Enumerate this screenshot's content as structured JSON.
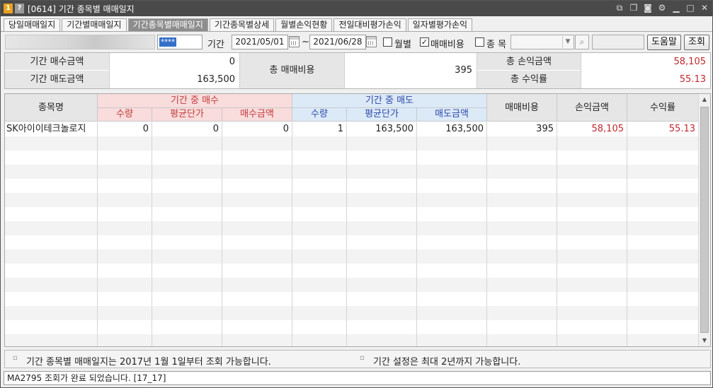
{
  "title": {
    "badge_num": "1",
    "badge_help": "?",
    "text": "[0614] 기간 종목별 매매일지"
  },
  "window_icons": [
    "link-icon",
    "copy-icon",
    "camera-icon",
    "gear-icon",
    "minimize-icon",
    "maximize-icon",
    "close-icon"
  ],
  "tabs": [
    {
      "label": "당일매매일지",
      "active": false
    },
    {
      "label": "기간별매매일지",
      "active": false
    },
    {
      "label": "기간종목별매매일지",
      "active": true
    },
    {
      "label": "기간종목별상세",
      "active": false
    },
    {
      "label": "월별손익현황",
      "active": false
    },
    {
      "label": "전일대비평가손익",
      "active": false
    },
    {
      "label": "일자별평가손익",
      "active": false
    }
  ],
  "toolbar": {
    "password_mask": "****",
    "period_label": "기간",
    "date_from": "2021/05/01",
    "tilde": "~",
    "date_to": "2021/06/28",
    "monthly_label": "월별",
    "monthly_checked": false,
    "fee_label": "매매비용",
    "fee_checked": true,
    "stock_label": "종 목",
    "stock_checked": false,
    "help_button": "도움말",
    "query_button": "조회"
  },
  "summary": {
    "buy_amount_label": "기간 매수금액",
    "buy_amount_value": "0",
    "sell_amount_label": "기간 매도금액",
    "sell_amount_value": "163,500",
    "total_fee_label": "총 매매비용",
    "total_fee_value": "395",
    "total_pnl_label": "총 손익금액",
    "total_pnl_value": "58,105",
    "total_return_label": "총 수익률",
    "total_return_value": "55.13"
  },
  "grid": {
    "col_name": "종목명",
    "buy_group": "기간 중 매수",
    "sell_group": "기간 중 매도",
    "qty": "수량",
    "avg_price": "평균단가",
    "buy_amount": "매수금액",
    "sell_amount": "매도금액",
    "fee": "매매비용",
    "pnl": "손익금액",
    "return_rate": "수익률",
    "rows": [
      {
        "name": "SK아이이테크놀로지",
        "buy_qty": "0",
        "buy_avg": "0",
        "buy_amount": "0",
        "sell_qty": "1",
        "sell_avg": "163,500",
        "sell_amount": "163,500",
        "fee": "395",
        "pnl": "58,105",
        "return_rate": "55.13"
      }
    ]
  },
  "notes": {
    "bullet": "▫",
    "note1": "기간 종목별 매매일지는 2017년 1월 1일부터 조회 가능합니다.",
    "note2": "기간 설정은 최대 2년까지 가능합니다."
  },
  "status": "MA2795 조회가 완료 되었습니다. [17_17]",
  "colors": {
    "titlebar": "#4a4a4a",
    "active_tab": "#8d8d8d",
    "buy_header_bg": "#f9dcdc",
    "buy_header_text": "#c03a3a",
    "sell_header_bg": "#dceaf8",
    "sell_header_text": "#2c47a8",
    "profit_text": "#c0282c"
  }
}
